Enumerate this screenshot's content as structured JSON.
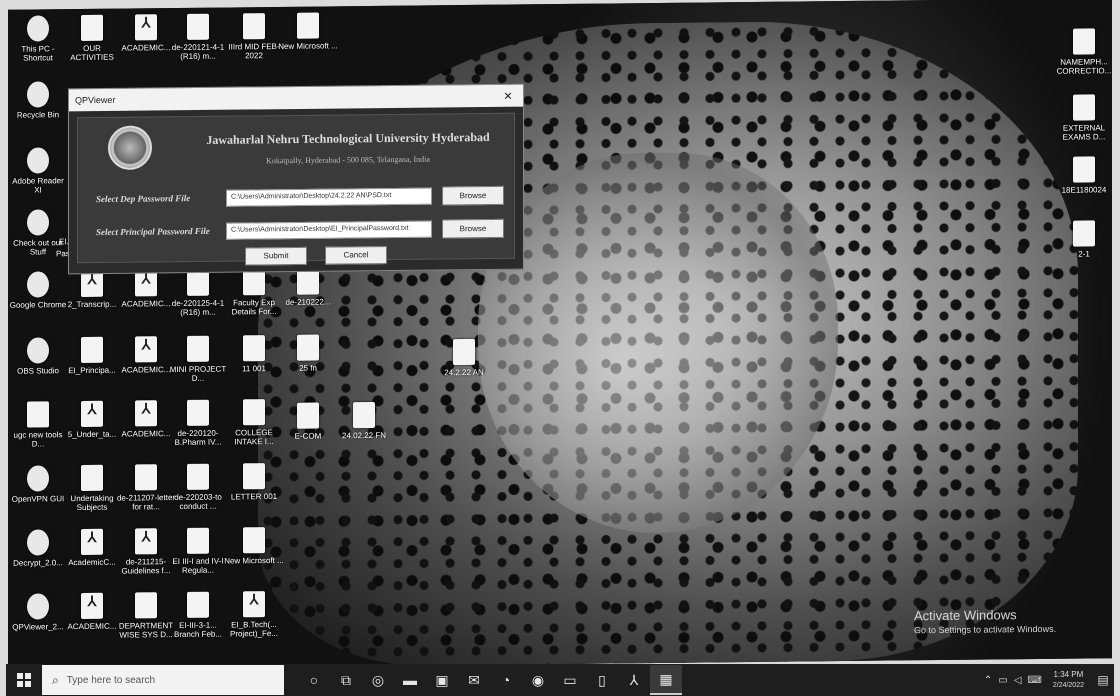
{
  "desktop": {
    "left_icons": [
      {
        "label": "This PC - Shortcut",
        "kind": "app"
      },
      {
        "label": "OUR ACTIVITIES",
        "kind": "doc"
      },
      {
        "label": "ACADEMIC...",
        "kind": "pdf"
      },
      {
        "label": "de-220121-4-1 (R16) m...",
        "kind": "doc"
      },
      {
        "label": "IIIrd MID FEB-2022",
        "kind": "doc"
      },
      {
        "label": "New Microsoft ...",
        "kind": "doc"
      },
      {
        "label": "Recycle Bin",
        "kind": "app"
      },
      {
        "label": "Adobe Reader XI",
        "kind": "app"
      },
      {
        "label": "Check out our Stuff",
        "kind": "app"
      },
      {
        "label": "Google Chrome",
        "kind": "app"
      },
      {
        "label": "2_Transcrip...",
        "kind": "pdf"
      },
      {
        "label": "ACADEMIC...",
        "kind": "pdf"
      },
      {
        "label": "de-220125-4-1 (R16) m...",
        "kind": "doc"
      },
      {
        "label": "Faculty Exp Details For...",
        "kind": "doc"
      },
      {
        "label": "de-210222...",
        "kind": "doc"
      },
      {
        "label": "OBS Studio",
        "kind": "app"
      },
      {
        "label": "EI_Principa...",
        "kind": "doc"
      },
      {
        "label": "ACADEMIC...",
        "kind": "pdf"
      },
      {
        "label": "MINI PROJECT D...",
        "kind": "doc"
      },
      {
        "label": "11 001",
        "kind": "doc"
      },
      {
        "label": "25 fn",
        "kind": "doc"
      },
      {
        "label": "24.2.22 AN",
        "kind": "doc"
      },
      {
        "label": "ugc new tools D...",
        "kind": "doc"
      },
      {
        "label": "5_Under_ta...",
        "kind": "pdf"
      },
      {
        "label": "ACADEMIC...",
        "kind": "pdf"
      },
      {
        "label": "de-220120-B.Pharm IV...",
        "kind": "doc"
      },
      {
        "label": "COLLEGE INTAKE I...",
        "kind": "doc"
      },
      {
        "label": "E-COM",
        "kind": "doc"
      },
      {
        "label": "24.02.22 FN",
        "kind": "doc"
      },
      {
        "label": "OpenVPN GUI",
        "kind": "app"
      },
      {
        "label": "Undertaking Subjects",
        "kind": "doc"
      },
      {
        "label": "de-211207-letter for rat...",
        "kind": "doc"
      },
      {
        "label": "de-220203-to conduct ...",
        "kind": "doc"
      },
      {
        "label": "LETTER 001",
        "kind": "doc"
      },
      {
        "label": "Decrypt_2.0...",
        "kind": "app"
      },
      {
        "label": "AcademicC...",
        "kind": "pdf"
      },
      {
        "label": "de-211215-Guidelines f...",
        "kind": "pdf"
      },
      {
        "label": "EI III-I and IV-I Regula...",
        "kind": "doc"
      },
      {
        "label": "New Microsoft ...",
        "kind": "doc"
      },
      {
        "label": "QPViewer_2...",
        "kind": "app"
      },
      {
        "label": "ACADEMIC...",
        "kind": "pdf"
      },
      {
        "label": "DEPARTMENT WISE SYS D...",
        "kind": "doc"
      },
      {
        "label": "EI-III-3-1... Branch Feb...",
        "kind": "doc"
      },
      {
        "label": "EI_B.Tech(... Project)_Fe...",
        "kind": "pdf"
      }
    ],
    "partial_labels": [
      "El...",
      "Pas..."
    ],
    "right_icons": [
      {
        "label": "NAMEMPH... CORRECTIO...",
        "kind": "doc"
      },
      {
        "label": "EXTERNAL EXAMS D...",
        "kind": "doc"
      },
      {
        "label": "18E1180024",
        "kind": "doc"
      },
      {
        "label": "2-1",
        "kind": "doc"
      }
    ],
    "activation": {
      "title": "Activate Windows",
      "subtitle": "Go to Settings to activate Windows."
    }
  },
  "dialog": {
    "title": "QPViewer",
    "university_name": "Jawaharlal Nehru Technological University Hyderabad",
    "university_address": "Kukatpally, Hyderabad - 500 085, Telangana, India",
    "dep_label": "Select Dep Password File",
    "dep_path": "C:\\Users\\Administrator\\Desktop\\24.2.22 AN\\PSD.txt",
    "principal_label": "Select Principal Password File",
    "principal_path": "C:\\Users\\Administrator\\Desktop\\EI_PrincipalPassword.txt",
    "browse_label": "Browse",
    "submit_label": "Submit",
    "cancel_label": "Cancel",
    "close_glyph": "✕"
  },
  "taskbar": {
    "search_placeholder": "Type here to search",
    "time": "1:34 PM",
    "date": "2/24/2022",
    "task_icons": [
      "cortana-icon",
      "task-view-icon",
      "edge-icon",
      "file-explorer-icon",
      "store-icon",
      "mail-icon",
      "firefox-icon",
      "chrome-icon",
      "folder-icon",
      "files-icon",
      "pdf-icon",
      "qpviewer-icon"
    ]
  }
}
